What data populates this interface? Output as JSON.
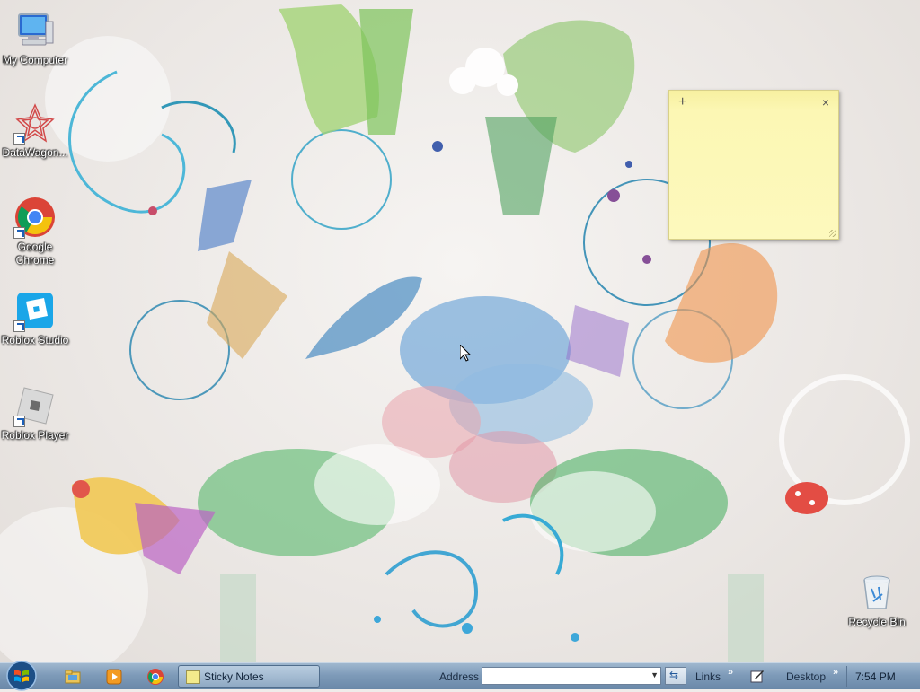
{
  "desktop": {
    "icons": [
      {
        "label": "My Computer",
        "icon": "computer-icon",
        "shortcut": false
      },
      {
        "label": "DataWagon...",
        "icon": "datawagon-icon",
        "shortcut": true
      },
      {
        "label": "Google Chrome",
        "icon": "chrome-icon",
        "shortcut": true
      },
      {
        "label": "Roblox Studio",
        "icon": "roblox-studio-icon",
        "shortcut": true
      },
      {
        "label": "Roblox Player",
        "icon": "roblox-player-icon",
        "shortcut": true
      },
      {
        "label": "Recycle Bin",
        "icon": "recycle-bin-icon",
        "shortcut": false
      }
    ]
  },
  "sticky_note": {
    "add_glyph": "+",
    "close_glyph": "×",
    "text": "",
    "color": "#fcf7b4"
  },
  "taskbar": {
    "start_icon": "windows-orb-icon",
    "quick_launch": [
      "explorer-icon",
      "media-player-icon",
      "chrome-icon"
    ],
    "task_button_label": "Sticky Notes",
    "address_label": "Address",
    "address_value": "",
    "links_label": "Links",
    "chevron": "»",
    "desktop_label": "Desktop",
    "clock": "7:54 PM"
  },
  "colors": {
    "taskbar": "#7e9bb9",
    "sticky_bg": "#fdf9bd",
    "desktop_bg": "#efecea"
  }
}
